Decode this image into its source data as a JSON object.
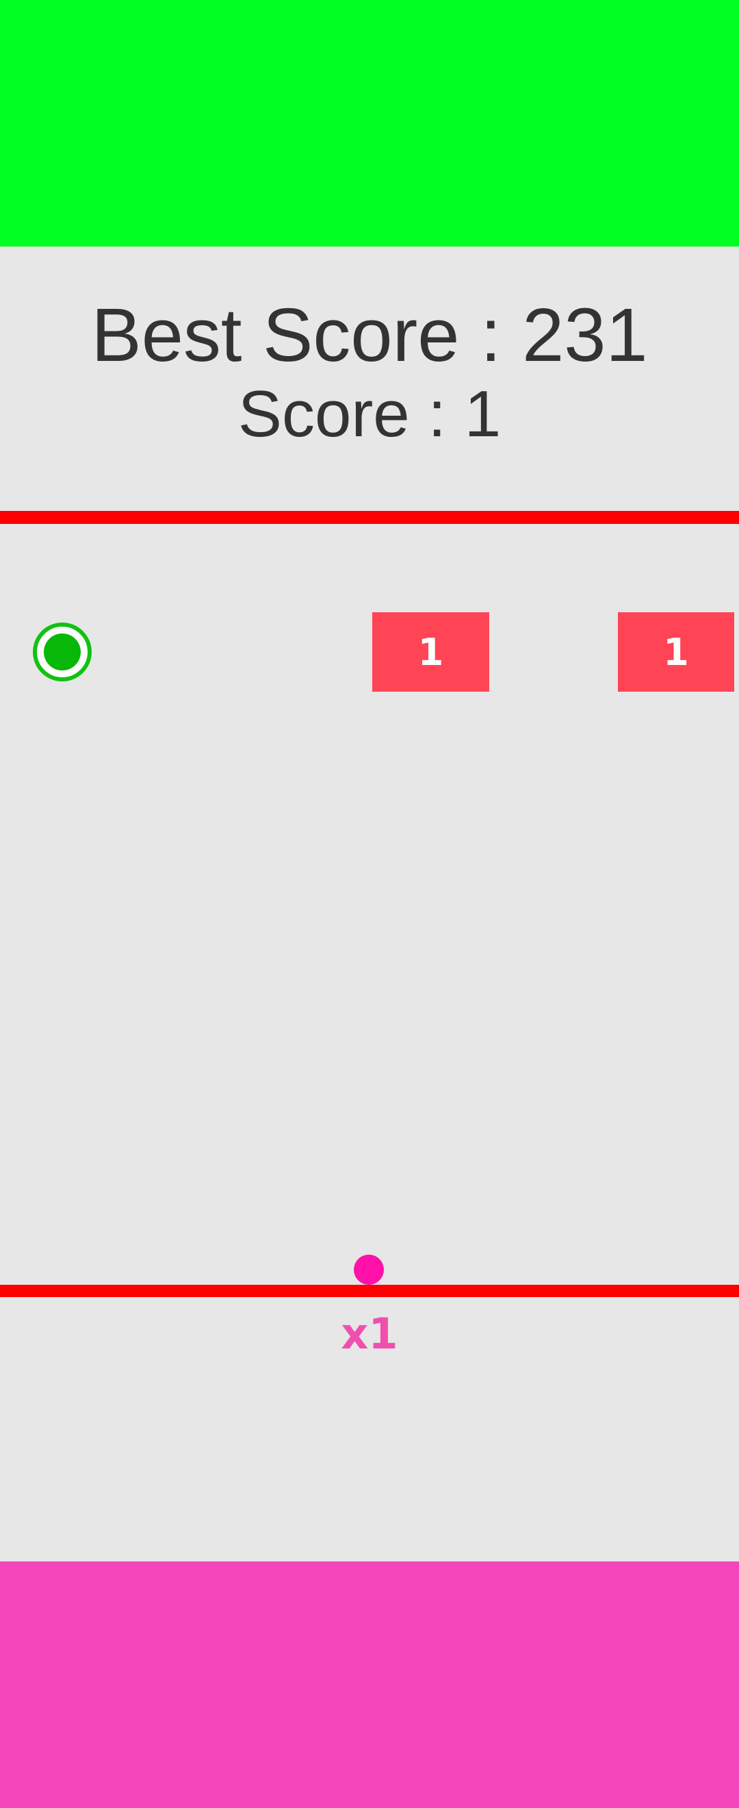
{
  "hud": {
    "best_score": "Best Score : 231",
    "score": "Score : 1"
  },
  "blocks": [
    {
      "value": "1"
    },
    {
      "value": "1"
    }
  ],
  "ball": {
    "multiplier": "x1"
  },
  "colors": {
    "top_band": "#00ff22",
    "bottom_band": "#f646bb",
    "background": "#e7e7e7",
    "boundary_line": "#ff0000",
    "block": "#ff4455",
    "ball": "#ff11aa",
    "ring_powerup": "#11c211"
  },
  "icons": {
    "powerup": "extra-ball-ring-icon"
  }
}
